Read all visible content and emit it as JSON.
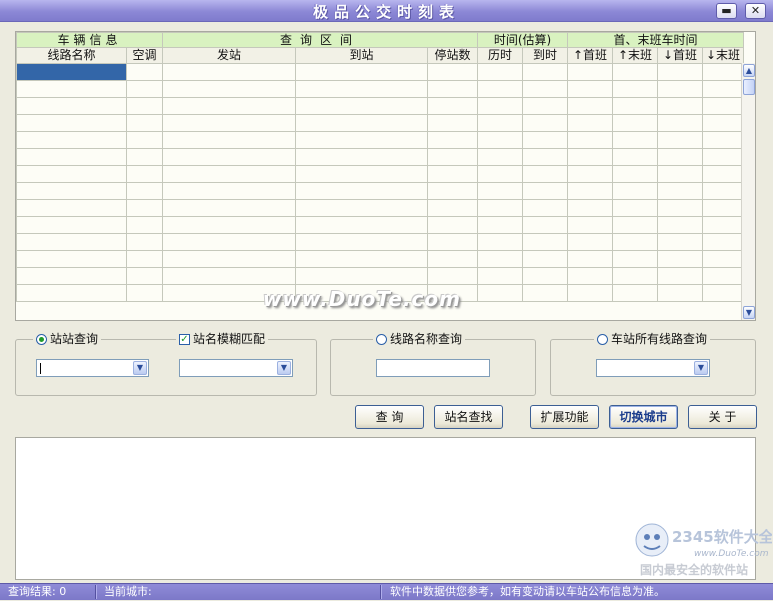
{
  "window": {
    "title": "极品公交时刻表",
    "minimize": "▬",
    "restore": "□",
    "close": "✕"
  },
  "table": {
    "group_headers": [
      "车辆信息",
      "查询区间",
      "时间(估算)",
      "首、末班车时间"
    ],
    "columns": [
      "线路名称",
      "空调",
      "发站",
      "到站",
      "停站数",
      "历时",
      "到时",
      "↑首班",
      "↑末班",
      "↓首班",
      "↓末班"
    ],
    "rows": [
      [
        "",
        "",
        "",
        "",
        "",
        "",
        "",
        "",
        "",
        "",
        ""
      ],
      [
        "",
        "",
        "",
        "",
        "",
        "",
        "",
        "",
        "",
        "",
        ""
      ],
      [
        "",
        "",
        "",
        "",
        "",
        "",
        "",
        "",
        "",
        "",
        ""
      ],
      [
        "",
        "",
        "",
        "",
        "",
        "",
        "",
        "",
        "",
        "",
        ""
      ],
      [
        "",
        "",
        "",
        "",
        "",
        "",
        "",
        "",
        "",
        "",
        ""
      ],
      [
        "",
        "",
        "",
        "",
        "",
        "",
        "",
        "",
        "",
        "",
        ""
      ],
      [
        "",
        "",
        "",
        "",
        "",
        "",
        "",
        "",
        "",
        "",
        ""
      ],
      [
        "",
        "",
        "",
        "",
        "",
        "",
        "",
        "",
        "",
        "",
        ""
      ],
      [
        "",
        "",
        "",
        "",
        "",
        "",
        "",
        "",
        "",
        "",
        ""
      ],
      [
        "",
        "",
        "",
        "",
        "",
        "",
        "",
        "",
        "",
        "",
        ""
      ],
      [
        "",
        "",
        "",
        "",
        "",
        "",
        "",
        "",
        "",
        "",
        ""
      ],
      [
        "",
        "",
        "",
        "",
        "",
        "",
        "",
        "",
        "",
        "",
        ""
      ],
      [
        "",
        "",
        "",
        "",
        "",
        "",
        "",
        "",
        "",
        "",
        ""
      ],
      [
        "",
        "",
        "",
        "",
        "",
        "",
        "",
        "",
        "",
        "",
        ""
      ]
    ],
    "selected_row": 0,
    "watermark": "www.DuoTe.com"
  },
  "search": {
    "station_query": {
      "label": "站站查询",
      "selected": true,
      "from_value": "",
      "to_value": ""
    },
    "fuzzy_match": {
      "label": "站名模糊匹配",
      "checked": true
    },
    "line_query": {
      "label": "线路名称查询",
      "selected": false,
      "value": ""
    },
    "station_lines_query": {
      "label": "车站所有线路查询",
      "selected": false,
      "value": ""
    }
  },
  "buttons": {
    "query": "查 询",
    "station_lookup": "站名查找",
    "extend": "扩展功能",
    "switch_city": "切换城市",
    "about": "关 于"
  },
  "logo": {
    "brand": "2345软件大全",
    "url": "www.DuoTe.com",
    "slogan": "国内最安全的软件站"
  },
  "status": {
    "result": "查询结果: 0",
    "city": "当前城市:",
    "notice": "软件中数据供您参考，如有变动请以车站公布信息为准。"
  },
  "colors": {
    "titlebar": "#8c88d6",
    "group_header": "#d9f2c0",
    "selection": "#3366a8",
    "statusbar": "#7c78c8"
  }
}
